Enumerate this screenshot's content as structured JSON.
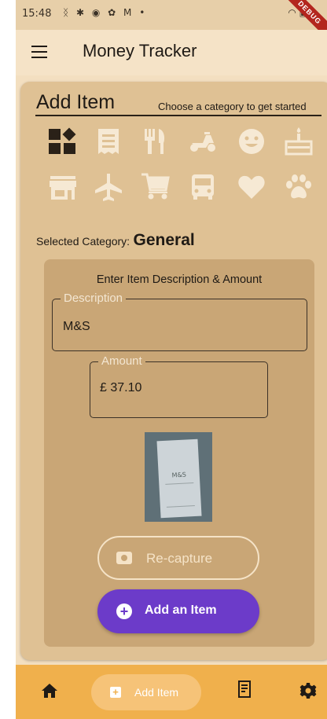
{
  "status_bar": {
    "time": "15:48",
    "left_icons": "ᛝ ✱ ◉ ✿ M •",
    "right_icons": "◠ ▣",
    "debug_label": "DEBUG"
  },
  "app_bar": {
    "menu_icon": "hamburger-menu-icon",
    "title": "Money Tracker"
  },
  "card": {
    "title": "Add Item",
    "subtitle": "Choose a category to get started",
    "categories": [
      {
        "icon": "dashboard-icon"
      },
      {
        "icon": "receipt-icon"
      },
      {
        "icon": "restaurant-icon"
      },
      {
        "icon": "moped-icon"
      },
      {
        "icon": "smiley-icon"
      },
      {
        "icon": "cake-icon"
      },
      {
        "icon": "storefront-icon"
      },
      {
        "icon": "flight-icon"
      },
      {
        "icon": "shopping-cart-icon"
      },
      {
        "icon": "bus-icon"
      },
      {
        "icon": "heart-icon"
      },
      {
        "icon": "pets-icon"
      }
    ],
    "selected_label": "Selected Category:",
    "selected_value": "General"
  },
  "form": {
    "title": "Enter Item Description & Amount",
    "description_label": "Description",
    "description_value": "M&S",
    "amount_label": "Amount",
    "amount_value": "£ 37.10",
    "receipt_text": "M&S",
    "recapture_label": "Re-capture",
    "add_label": "Add an Item"
  },
  "bottom_nav": {
    "add_label": "Add Item"
  },
  "colors": {
    "background": "#f3dfc0",
    "card": "#dfc194",
    "inner_panel": "#c9a676",
    "category_icon": "#f6e9d4",
    "primary_button": "#6c3bc9",
    "bottom_nav": "#f0b04c"
  }
}
